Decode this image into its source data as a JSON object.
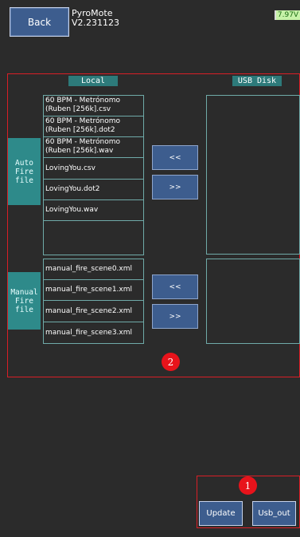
{
  "header": {
    "back_label": "Back",
    "app_name": "PyroMote",
    "version": "V2.231123",
    "battery": "7.97V"
  },
  "columns": {
    "local": "Local",
    "usb": "USB Disk"
  },
  "sections": {
    "auto": {
      "label_lines": [
        "Auto",
        "Fire",
        "file"
      ],
      "local_files": [
        "60 BPM - Metrónomo (Ruben [256k].csv",
        "60 BPM - Metrónomo (Ruben [256k].dot2",
        "60 BPM - Metrónomo (Ruben [256k].wav",
        "LovingYou.csv",
        "LovingYou.dot2",
        "LovingYou.wav"
      ],
      "copy_to_local": "<<",
      "copy_to_usb": ">>"
    },
    "manual": {
      "label_lines": [
        "Manual",
        "Fire",
        "file"
      ],
      "local_files": [
        "manual_fire_scene0.xml",
        "manual_fire_scene1.xml",
        "manual_fire_scene2.xml",
        "manual_fire_scene3.xml"
      ],
      "copy_to_local": "<<",
      "copy_to_usb": ">>"
    }
  },
  "markers": {
    "transfer": "2",
    "actions": "1"
  },
  "actions": {
    "update_label": "Update",
    "usb_out_label": "Usb_out"
  },
  "colors": {
    "background": "#2b2b2b",
    "button": "#3d5d8e",
    "teal": "#2e8a8a",
    "highlight": "#d81f26",
    "battery": "#c7f2a8"
  }
}
